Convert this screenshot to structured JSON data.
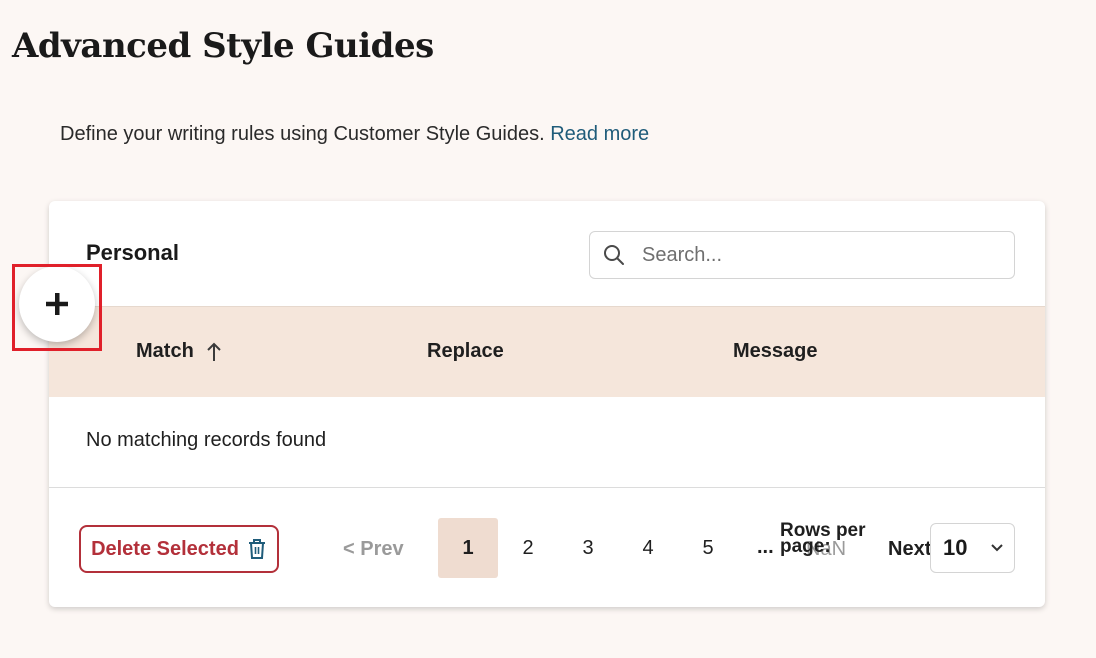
{
  "page": {
    "title": "Advanced Style Guides",
    "intro_text": "Define your writing rules using Customer Style Guides.",
    "read_more_label": "Read more"
  },
  "card": {
    "title": "Personal",
    "search_placeholder": "Search...",
    "columns": {
      "match": "Match",
      "replace": "Replace",
      "message": "Message"
    },
    "sort_direction": "ascending",
    "empty_message": "No matching records found"
  },
  "footer": {
    "delete_label": "Delete Selected",
    "prev_label": "< Prev",
    "pages": [
      "1",
      "2",
      "3",
      "4",
      "5"
    ],
    "current_page": "1",
    "ellipsis": "...",
    "nan_label": "NaN",
    "rows_per_page_label": "Rows per page:",
    "next_label": "Next",
    "rows_per_page_value": "10"
  },
  "colors": {
    "header_bg": "#f5e6db",
    "accent_link": "#1f5c7a",
    "danger": "#b3303a",
    "active_page_bg": "#efdcd0",
    "highlight_box": "#e0202a"
  },
  "icons": [
    "search-icon",
    "sort-ascending-icon",
    "trash-icon",
    "chevron-down-icon",
    "plus-icon"
  ]
}
